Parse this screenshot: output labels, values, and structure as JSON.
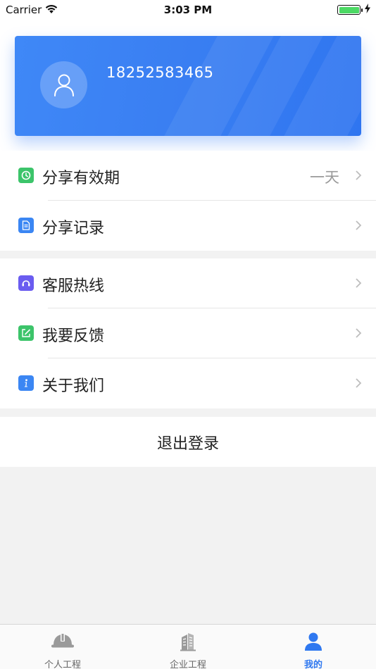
{
  "status_bar": {
    "carrier": "Carrier",
    "time": "3:03 PM"
  },
  "profile": {
    "phone": "18252583465",
    "avatar_icon": "user-outline-icon",
    "card_color": "#3a7ff2"
  },
  "menu_group_1": [
    {
      "label": "分享有效期",
      "value": "一天",
      "icon": "clock-icon",
      "icon_color": "#3cc46a"
    },
    {
      "label": "分享记录",
      "value": "",
      "icon": "document-icon",
      "icon_color": "#3b86f3"
    }
  ],
  "menu_group_2": [
    {
      "label": "客服热线",
      "icon": "headset-icon",
      "icon_color": "#6a5cf0"
    },
    {
      "label": "我要反馈",
      "icon": "edit-icon",
      "icon_color": "#3cc46a"
    },
    {
      "label": "关于我们",
      "icon": "info-icon",
      "icon_color": "#3b86f3"
    }
  ],
  "logout_label": "退出登录",
  "tabs": [
    {
      "label": "个人工程",
      "icon": "helmet-icon",
      "active": false
    },
    {
      "label": "企业工程",
      "icon": "building-icon",
      "active": false
    },
    {
      "label": "我的",
      "icon": "person-icon",
      "active": true
    }
  ],
  "colors": {
    "accent": "#2f78f0",
    "background": "#f2f2f2"
  }
}
